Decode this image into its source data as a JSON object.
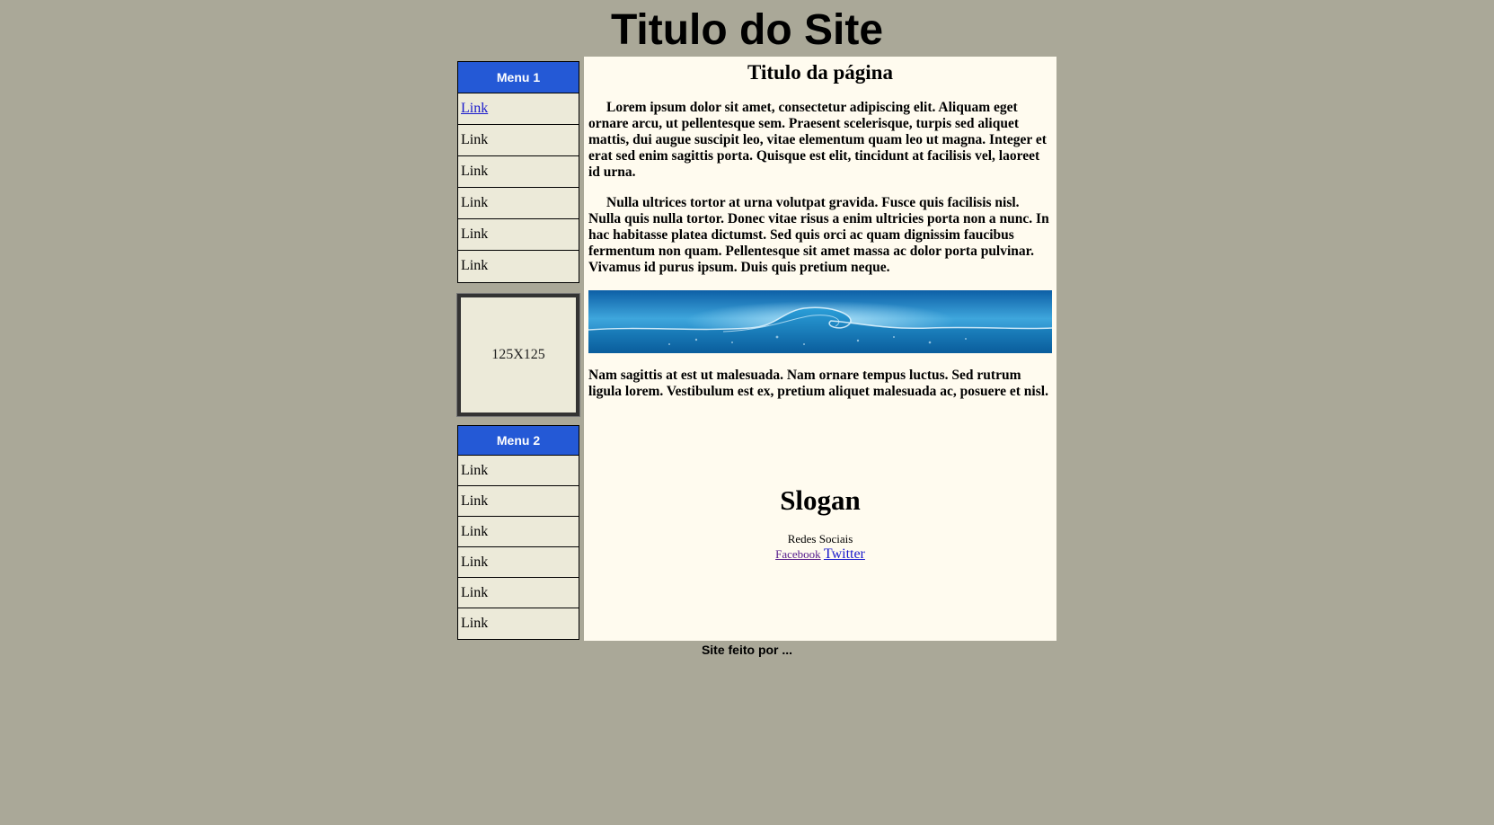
{
  "header": {
    "title": "Titulo do Site"
  },
  "sidebar": {
    "menu1": {
      "title": "Menu 1",
      "items": [
        {
          "label": "Link"
        },
        {
          "label": "Link"
        },
        {
          "label": "Link"
        },
        {
          "label": "Link"
        },
        {
          "label": "Link"
        },
        {
          "label": "Link"
        }
      ]
    },
    "ad": {
      "label": "125X125"
    },
    "menu2": {
      "title": "Menu 2",
      "items": [
        {
          "label": "Link"
        },
        {
          "label": "Link"
        },
        {
          "label": "Link"
        },
        {
          "label": "Link"
        },
        {
          "label": "Link"
        },
        {
          "label": "Link"
        }
      ]
    }
  },
  "main": {
    "title": "Titulo da página",
    "paragraphs": [
      "Lorem ipsum dolor sit amet, consectetur adipiscing elit. Aliquam eget ornare arcu, ut pellentesque sem. Praesent scelerisque, turpis sed aliquet mattis, dui augue suscipit leo, vitae elementum quam leo ut magna. Integer et erat sed enim sagittis porta. Quisque est elit, tincidunt at facilisis vel, laoreet id urna.",
      "Nulla ultrices tortor at urna volutpat gravida. Fusce quis facilisis nisl. Nulla quis nulla tortor. Donec vitae risus a enim ultricies porta non a nunc. In hac habitasse platea dictumst. Sed quis orci ac quam dignissim faucibus fermentum non quam. Pellentesque sit amet massa ac dolor porta pulvinar. Vivamus id purus ipsum. Duis quis pretium neque.",
      "Nam sagittis at est ut malesuada. Nam ornare tempus luctus. Sed rutrum ligula lorem. Vestibulum est ex, pretium aliquet malesuada ac, posuere et nisl."
    ],
    "slogan": "Slogan",
    "social": {
      "heading": "Redes Sociais",
      "facebook": "Facebook",
      "twitter": "Twitter"
    }
  },
  "footer": {
    "text": "Site feito por ..."
  },
  "colors": {
    "page_background": "#aaa898",
    "menu_header": "#2459d6",
    "menu_item_background": "#ecead9",
    "content_background": "#fffbef"
  }
}
